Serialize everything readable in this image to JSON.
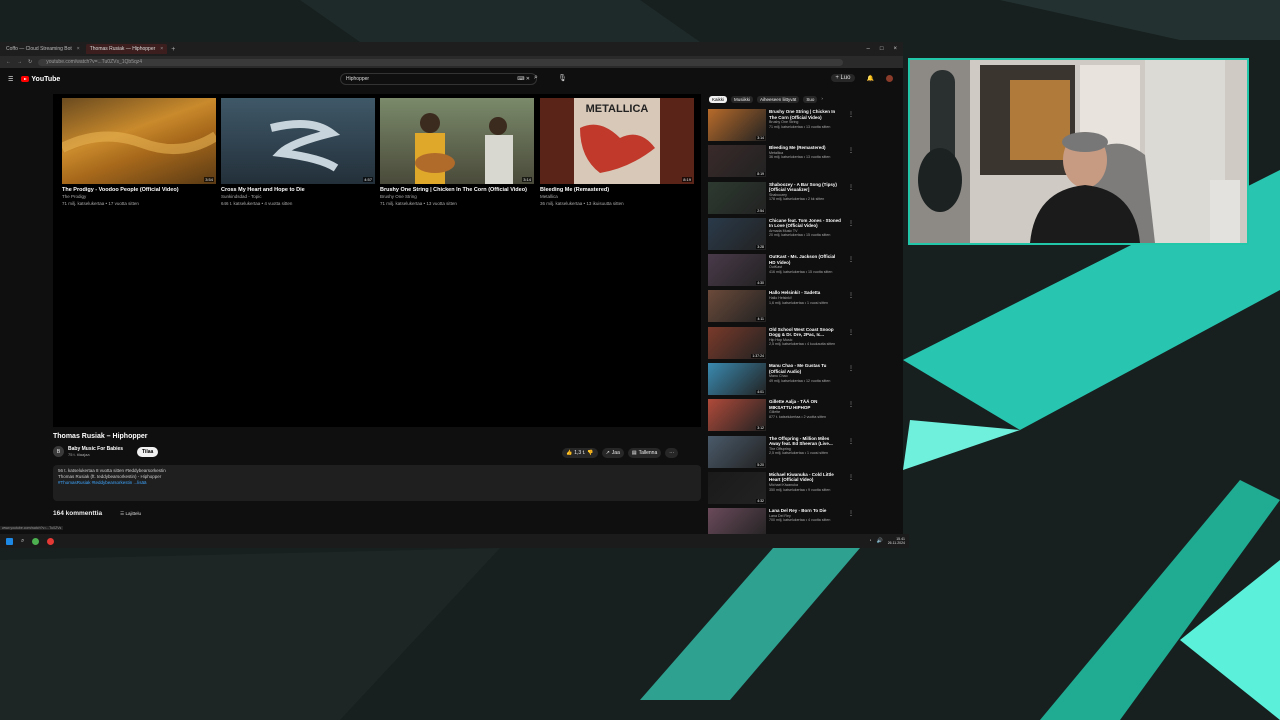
{
  "browser": {
    "tabs": [
      {
        "label": "Coffo — Cloud Streaming Bot"
      },
      {
        "label": "Thomas Rusiak — Hiphopper"
      }
    ],
    "new_tab": "+",
    "url": "youtube.com/watch?v=...Tu0ZVs_1Qb5qz4"
  },
  "youtube": {
    "logo": "YouTube",
    "search_query": "Hiphopper",
    "create_label": "Luo",
    "player": {
      "endcards": [
        {
          "title": "The Prodigy - Voodoo People (Official Video)",
          "channel": "The Prodigy",
          "meta": "71 milj. katselukertaa • 17 vuotta sitten",
          "duration": "3:54"
        },
        {
          "title": "Cross My Heart and Hope to Die",
          "channel": "Sunkindsdad - Topic",
          "meta": "646 t. katselukertaa • 4 vuotta sitten",
          "duration": "4:57"
        },
        {
          "title": "Brushy One String | Chicken In The Corn (Official Video)",
          "channel": "Brushy One String",
          "meta": "71 milj. katselukertaa • 13 vuotta sitten",
          "duration": "3:14"
        },
        {
          "title": "Bleeding Me (Remastered)",
          "channel": "Metallica",
          "meta": "36 milj. katselukertaa • 13 ikuisuutta sitten",
          "duration": "8:19"
        }
      ]
    },
    "video": {
      "title": "Thomas Rusiak – Hiphopper",
      "channel": "Baby Music For Babies",
      "channel_initial": "B",
      "subscribers": "75 t. tilaajaa",
      "subscribe": "Tilaa",
      "likes": "1,3 t.",
      "share": "Jaa",
      "save": "Tallenna",
      "description_lines": [
        "56 t. katselukertaa  8 vuotta sitten  #teddybearsorkestin",
        "Thomas Rusiak (ft. teddybearsorkestin) - Hiphopper",
        "#ThomasRusiak #teddybearsorkestin ...lisää"
      ],
      "comments_count": "164 kommenttia",
      "sort_label": "Lajittelu"
    },
    "chips": [
      "Kaikki",
      "Musiikki",
      "Aiheeseen liittyvät",
      "Suo"
    ],
    "sidebar": [
      {
        "title": "Brushy One String | Chicken In The Corn (Official Video)",
        "channel": "Brushy One String",
        "meta": "71 milj. katselukertaa • 13 vuotta sitten",
        "duration": "3:14"
      },
      {
        "title": "Bleeding Me (Remastered)",
        "channel": "Metallica",
        "meta": "36 milj. katselukertaa • 13 vuotta sitten",
        "duration": "8:19"
      },
      {
        "title": "Shaboozey - A Bar Song (Tipsy) [Official Visualizer]",
        "channel": "Shaboozey",
        "meta": "178 milj. katselukertaa • 2 kk sitten",
        "duration": "2:54"
      },
      {
        "title": "Chicane feat. Tom Jones - Stoned In Love (Official Video)",
        "channel": "Armada Music TV",
        "meta": "20 milj. katselukertaa • 15 vuotta sitten",
        "duration": "3:28"
      },
      {
        "title": "OutKast - Ms. Jackson (Official HD Video)",
        "channel": "OutKast",
        "meta": "416 milj. katselukertaa • 15 vuotta sitten",
        "duration": "4:30"
      },
      {
        "title": "Hallo Helsinki! - Sadetta",
        "channel": "Hallo Helsinki!",
        "meta": "1,6 milj. katselukertaa • 1 vuosi sitten",
        "duration": "4:11"
      },
      {
        "title": "Old School West Coast Snoop Dogg & Dr. Dre, 2Pac, Ic...",
        "channel": "Hip Hop Music",
        "meta": "2,5 milj. katselukertaa • 4 kuukautta sitten",
        "duration": "1:37:24"
      },
      {
        "title": "Manu Chao - Me Gustas Tu (Official Audio)",
        "channel": "Manu Chao",
        "meta": "49 milj. katselukertaa • 12 vuotta sitten",
        "duration": "4:01"
      },
      {
        "title": "Gillette Aalja - TÄÄ ON MIKSATTU HIPHOP",
        "channel": "Gillette",
        "meta": "877 t. katselukertaa • 2 vuotta sitten",
        "duration": "3:12"
      },
      {
        "title": "The Offspring - Million Miles Away feat. Ed Sheeran (Live...",
        "channel": "The Offspring",
        "meta": "2,5 milj. katselukertaa • 1 vuosi sitten",
        "duration": "5:20"
      },
      {
        "title": "Michael Kiwanuka - Cold Little Heart (Official Video)",
        "channel": "Michael Kiwanuka",
        "meta": "350 milj. katselukertaa • 9 vuotta sitten",
        "duration": "4:32"
      },
      {
        "title": "Lana Del Rey - Born To Die",
        "channel": "Lana Del Rey",
        "meta": "700 milj. katselukertaa • 4 vuotta sitten",
        "duration": "4:46"
      }
    ]
  },
  "status_url": "www.youtube.com/watch?v=...Tu0ZVs",
  "taskbar": {
    "time": "15.41",
    "date": "26.11.2024"
  }
}
